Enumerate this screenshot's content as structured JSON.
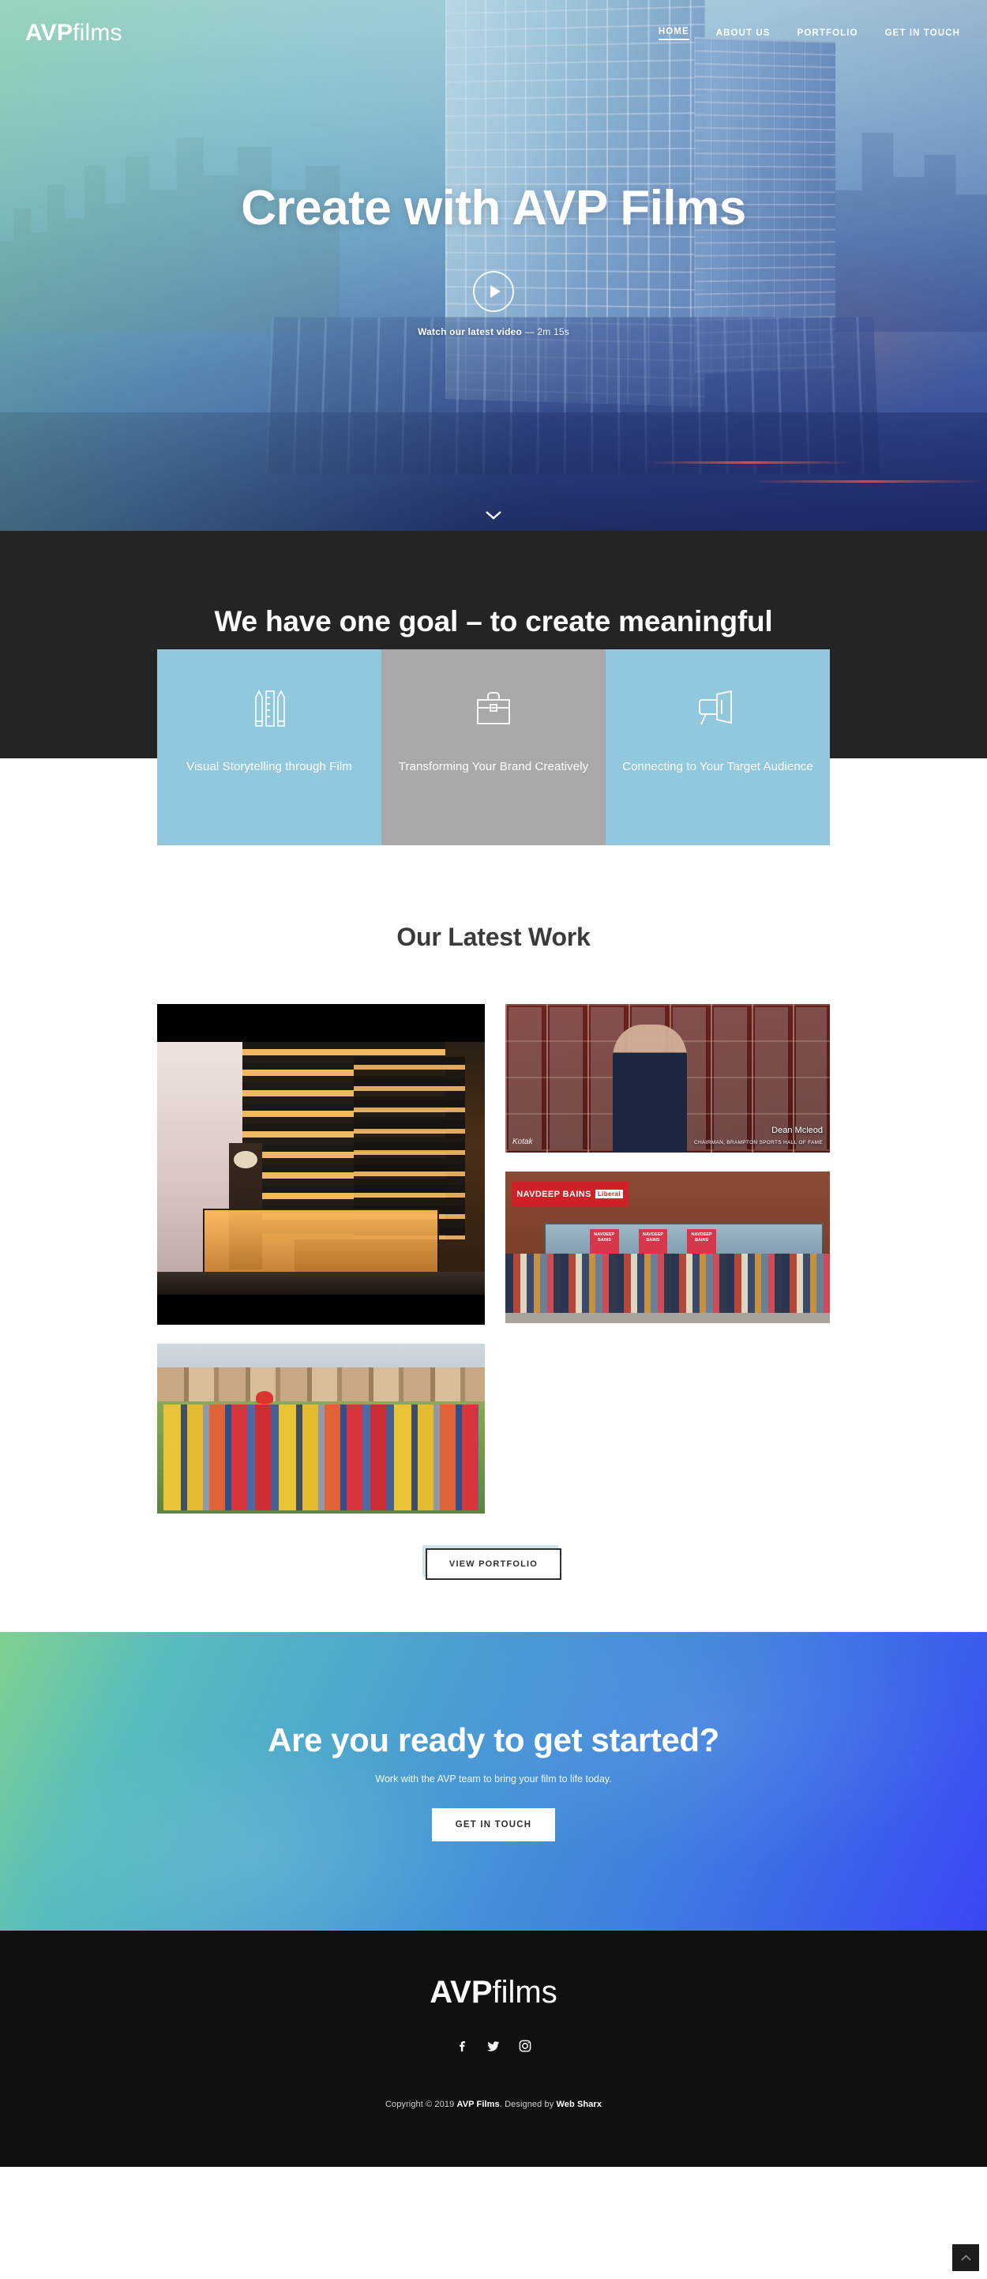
{
  "brand": {
    "bold": "AVP",
    "light": "films"
  },
  "nav": {
    "items": [
      {
        "label": "HOME",
        "active": true
      },
      {
        "label": "ABOUT US",
        "active": false
      },
      {
        "label": "PORTFOLIO",
        "active": false
      },
      {
        "label": "GET IN TOUCH",
        "active": false
      }
    ]
  },
  "hero": {
    "title": "Create with AVP Films",
    "play_icon": "play-circle-icon",
    "watch_label": "Watch our latest video",
    "watch_duration": " — 2m 15s",
    "scroll_icon": "chevron-down-icon"
  },
  "goal": {
    "headline": "We have one goal – to create meaningful content that actually works."
  },
  "features": {
    "cards": [
      {
        "icon": "pencil-ruler-icon",
        "label": "Visual Storytelling through Film",
        "color": "#92c8dd"
      },
      {
        "icon": "briefcase-icon",
        "label": "Transforming Your Brand Creatively",
        "color": "#a9a9a9"
      },
      {
        "icon": "megaphone-icon",
        "label": "Connecting to Your Target Audience",
        "color": "#92c8dd"
      }
    ]
  },
  "work": {
    "heading": "Our Latest Work",
    "tiles": [
      {
        "name": "downtown-building-render",
        "caption": ""
      },
      {
        "name": "sports-hall-of-fame",
        "caption": "Dean Mcleod",
        "subcaption": "CHAIRMAN, BRAMPTON SPORTS HALL OF FAME",
        "watermark": "Kotak"
      },
      {
        "name": "navdeep-bains-campaign",
        "caption": "NAVDEEP BAINS",
        "badge": "Liberal",
        "poster": "NAVDEEP BAINS"
      },
      {
        "name": "community-youth-cricket",
        "caption": ""
      }
    ],
    "button_label": "VIEW PORTFOLIO"
  },
  "cta": {
    "heading": "Are you ready to get started?",
    "subheading": "Work with the AVP team to bring your film to life today.",
    "button_label": "GET IN TOUCH"
  },
  "footer": {
    "logo_bold": "AVP",
    "logo_light": "films",
    "socials": [
      {
        "name": "facebook-icon",
        "glyph": "f"
      },
      {
        "name": "twitter-icon",
        "glyph": "t"
      },
      {
        "name": "instagram-icon",
        "glyph": "i"
      }
    ],
    "copyright_prefix": "Copyright © 2019 ",
    "copyright_brand": "AVP Films",
    "copyright_mid": ". Designed by ",
    "copyright_designer": "Web Sharx"
  },
  "scroll_top": {
    "icon": "chevron-up-icon"
  }
}
